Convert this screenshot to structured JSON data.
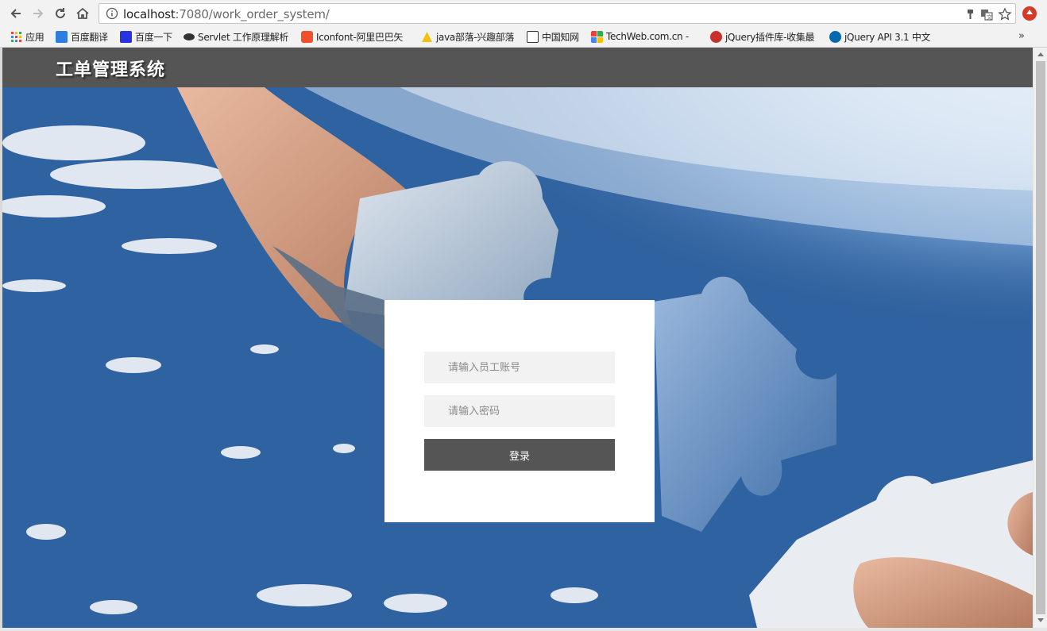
{
  "browser": {
    "url_host": "localhost",
    "url_path": ":7080/work_order_system/",
    "bookmarks": [
      {
        "label": "应用",
        "icon": "apps-grid-icon"
      },
      {
        "label": "百度翻译",
        "icon": "baidu-translate-icon"
      },
      {
        "label": "百度一下",
        "icon": "baidu-paw-icon"
      },
      {
        "label": "Servlet 工作原理解析",
        "icon": "servlet-icon"
      },
      {
        "label": "Iconfont-阿里巴巴矢",
        "icon": "iconfont-icon"
      },
      {
        "label": "java部落-兴趣部落",
        "icon": "java-tribe-icon"
      },
      {
        "label": "中国知网",
        "icon": "cnki-icon"
      },
      {
        "label": "TechWeb.com.cn - ",
        "icon": "techweb-icon"
      },
      {
        "label": "jQuery插件库-收集最",
        "icon": "jquery-plugins-icon"
      },
      {
        "label": "jQuery API 3.1 中文",
        "icon": "jquery-api-icon"
      }
    ],
    "more_bookmarks": "»"
  },
  "app": {
    "title": "工单管理系统"
  },
  "login": {
    "account_placeholder": "请输入员工账号",
    "account_value": "",
    "password_placeholder": "请输入密码",
    "password_value": "",
    "submit_label": "登录"
  },
  "colors": {
    "header_bg": "#555555",
    "button_bg": "#555555",
    "input_bg": "#f2f2f2",
    "card_bg": "#ffffff"
  }
}
